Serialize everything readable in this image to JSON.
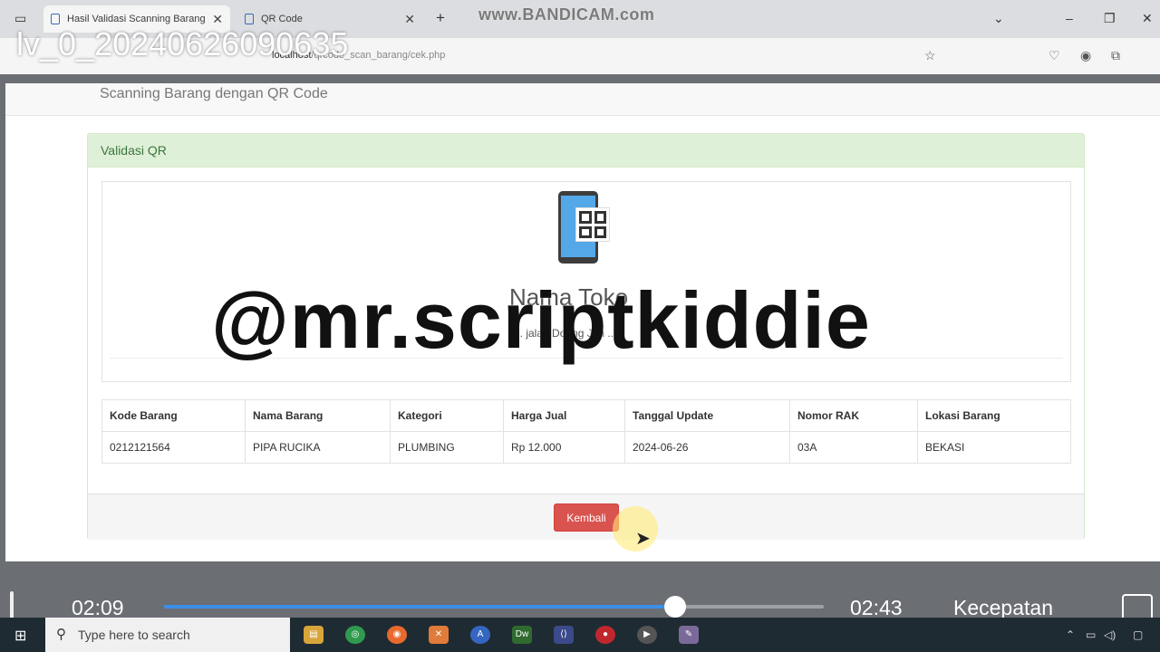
{
  "browser": {
    "tabs": [
      {
        "label": "Hasil Validasi Scanning Barang"
      },
      {
        "label": "QR Code"
      }
    ],
    "recorder_watermark": "www.BANDICAM.com",
    "url_host": "localhost",
    "url_path": "/qrcode_scan_barang/cek.php",
    "recording_name": "lv_0_20240626090635"
  },
  "page": {
    "brand": "Scanning Barang dengan QR Code",
    "panel_title": "Validasi QR",
    "store_name": "Nama Toko",
    "store_address": "Jl. jalan Doang Jan ..."
  },
  "table": {
    "headers": [
      "Kode Barang",
      "Nama Barang",
      "Kategori",
      "Harga Jual",
      "Tanggal Update",
      "Nomor RAK",
      "Lokasi Barang"
    ],
    "rows": [
      [
        "0212121564",
        "PIPA RUCIKA",
        "PLUMBING",
        "Rp 12.000",
        "2024-06-26",
        "03A",
        "BEKASI"
      ]
    ]
  },
  "actions": {
    "back_label": "Kembali"
  },
  "overlay": {
    "watermark": "@mr.scriptkiddie"
  },
  "player": {
    "current_time": "02:09",
    "total_time": "02:43",
    "progress": 0.775,
    "speed_label": "Kecepatan"
  },
  "taskbar": {
    "search_placeholder": "Type here to search"
  },
  "colors": {
    "panel_heading_bg": "#dff0d8",
    "panel_heading_text": "#3c763d",
    "danger": "#d9534f",
    "seek_fill": "#3b8fe8"
  }
}
